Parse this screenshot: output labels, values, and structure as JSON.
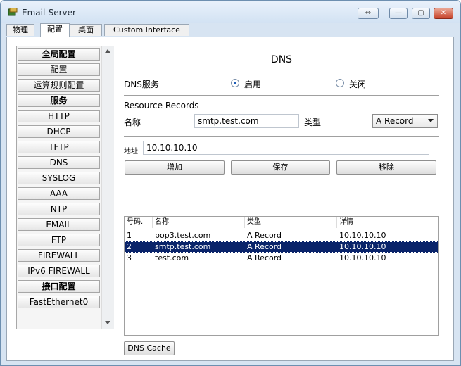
{
  "window": {
    "title": "Email-Server",
    "controls": {
      "swap": "⇔",
      "minimize": "—",
      "maximize": "▢",
      "close": "✕"
    }
  },
  "tabs": [
    {
      "label": "物理",
      "active": false
    },
    {
      "label": "配置",
      "active": true
    },
    {
      "label": "桌面",
      "active": false
    },
    {
      "label": "Custom Interface",
      "active": false
    }
  ],
  "sidebar": {
    "items": [
      {
        "label": "全局配置",
        "header": true
      },
      {
        "label": "配置",
        "header": false
      },
      {
        "label": "运算规则配置",
        "header": false
      },
      {
        "label": "服务",
        "header": true
      },
      {
        "label": "HTTP",
        "header": false
      },
      {
        "label": "DHCP",
        "header": false
      },
      {
        "label": "TFTP",
        "header": false
      },
      {
        "label": "DNS",
        "header": false
      },
      {
        "label": "SYSLOG",
        "header": false
      },
      {
        "label": "AAA",
        "header": false
      },
      {
        "label": "NTP",
        "header": false
      },
      {
        "label": "EMAIL",
        "header": false
      },
      {
        "label": "FTP",
        "header": false
      },
      {
        "label": "FIREWALL",
        "header": false
      },
      {
        "label": "IPv6 FIREWALL",
        "header": false
      },
      {
        "label": "接口配置",
        "header": true
      },
      {
        "label": "FastEthernet0",
        "header": false
      }
    ]
  },
  "dns": {
    "title": "DNS",
    "service_label": "DNS服务",
    "on_label": "启用",
    "off_label": "关闭",
    "service_on": true,
    "resource_records_label": "Resource Records",
    "name_label": "名称",
    "name_value": "smtp.test.com",
    "type_label": "类型",
    "type_value": "A Record",
    "address_label": "地址",
    "address_value": "10.10.10.10",
    "add_button": "增加",
    "save_button": "保存",
    "remove_button": "移除",
    "table": {
      "columns": [
        "号码.",
        "名称",
        "类型",
        "详情"
      ],
      "rows": [
        [
          "1",
          "pop3.test.com",
          "A Record",
          "10.10.10.10"
        ],
        [
          "2",
          "smtp.test.com",
          "A Record",
          "10.10.10.10"
        ],
        [
          "3",
          "test.com",
          "A Record",
          "10.10.10.10"
        ]
      ],
      "selected_row": 1
    },
    "cache_button": "DNS Cache"
  },
  "colors": {
    "selection": "#0a246a",
    "radio_dot": "#1e5eb8"
  }
}
